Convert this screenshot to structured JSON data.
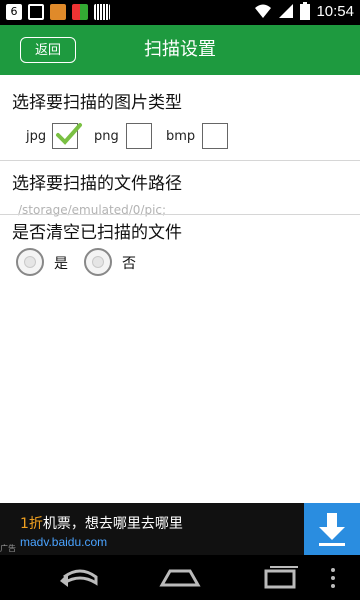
{
  "status_bar": {
    "time": "10:54",
    "icons": [
      "notification-6-icon",
      "download-icon",
      "app-icon",
      "app-icon",
      "barcode-icon",
      "wifi-icon",
      "signal-icon",
      "battery-icon"
    ]
  },
  "app_bar": {
    "back_label": "返回",
    "title": "扫描设置",
    "color": "#1e9a3f"
  },
  "file_types": {
    "title": "选择要扫描的图片类型",
    "options": [
      {
        "label": "jpg",
        "checked": true
      },
      {
        "label": "png",
        "checked": false
      },
      {
        "label": "bmp",
        "checked": false
      }
    ]
  },
  "file_path": {
    "title": "选择要扫描的文件路径",
    "value": "/storage/emulated/0/pic;"
  },
  "clear_files": {
    "title": "是否清空已扫描的文件",
    "options": [
      {
        "label": "是",
        "selected": false
      },
      {
        "label": "否",
        "selected": false
      }
    ]
  },
  "ad": {
    "headline_highlight": "1折",
    "headline_rest": "机票，想去哪里去哪里",
    "url": "madv.baidu.com",
    "badge": "广告"
  },
  "nav_bar": {
    "icons": [
      "back-icon",
      "home-icon",
      "recent-apps-icon",
      "menu-icon"
    ]
  }
}
